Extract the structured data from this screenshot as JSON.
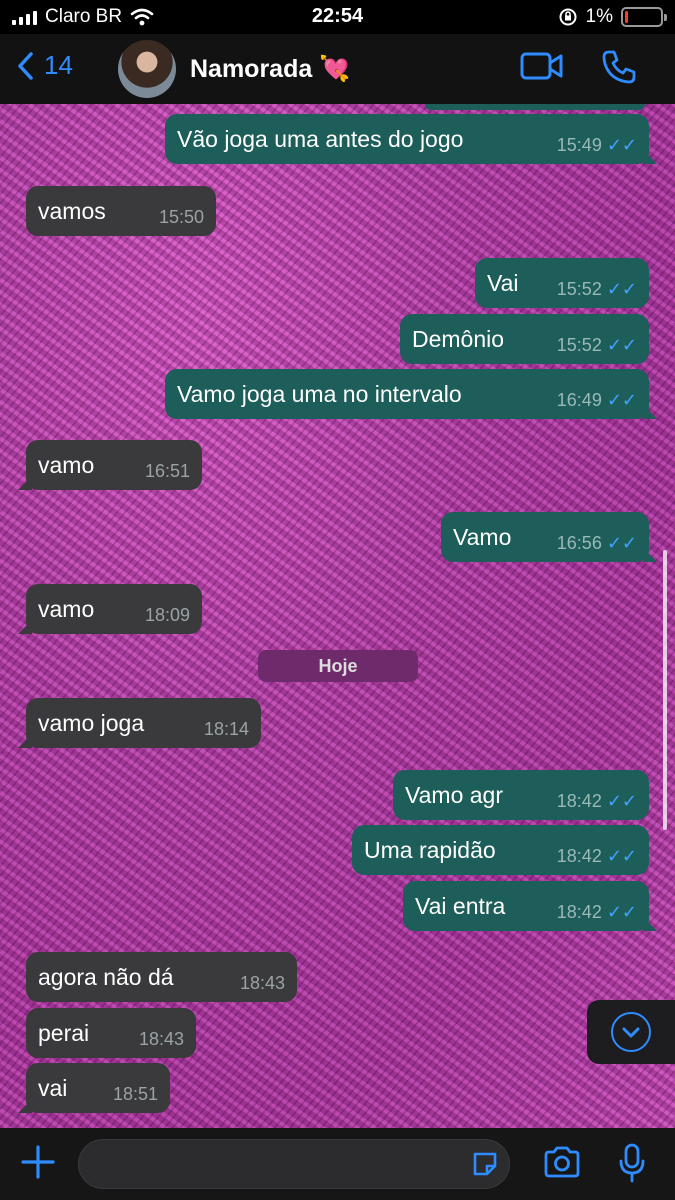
{
  "status_bar": {
    "carrier": "Claro BR",
    "time": "22:54",
    "battery_percent": "1%",
    "battery_level": 0.05,
    "icons": [
      "signal-icon",
      "wifi-icon",
      "rotation-lock-icon",
      "battery-icon"
    ]
  },
  "header": {
    "back_count": "14",
    "contact_name": "Namorada 💘",
    "icons": [
      "chevron-left-icon",
      "video-call-icon",
      "phone-icon"
    ]
  },
  "messages": [
    {
      "dir": "out",
      "text": "Vão joga uma antes do jogo",
      "time": "15:49",
      "read": true
    },
    {
      "dir": "in",
      "text": "vamos",
      "time": "15:50"
    },
    {
      "dir": "out",
      "text": "Vai",
      "time": "15:52",
      "read": true
    },
    {
      "dir": "out",
      "text": "Demônio",
      "time": "15:52",
      "read": true
    },
    {
      "dir": "out",
      "text": "Vamo joga uma no intervalo",
      "time": "16:49",
      "read": true
    },
    {
      "dir": "in",
      "text": "vamo",
      "time": "16:51"
    },
    {
      "dir": "out",
      "text": "Vamo",
      "time": "16:56",
      "read": true
    },
    {
      "dir": "in",
      "text": "vamo",
      "time": "18:09"
    },
    {
      "dir": "in",
      "text": "vamo joga",
      "time": "18:14"
    },
    {
      "dir": "out",
      "text": "Vamo agr",
      "time": "18:42",
      "read": true
    },
    {
      "dir": "out",
      "text": "Uma rapidão",
      "time": "18:42",
      "read": true
    },
    {
      "dir": "out",
      "text": "Vai entra",
      "time": "18:42",
      "read": true
    },
    {
      "dir": "in",
      "text": "agora não dá",
      "time": "18:43"
    },
    {
      "dir": "in",
      "text": "perai",
      "time": "18:43"
    },
    {
      "dir": "in",
      "text": "vai",
      "time": "18:51"
    }
  ],
  "date_divider": "Hoje",
  "read_ticks": "✓✓",
  "colors": {
    "accent": "#2f8cff",
    "incoming_bubble": "#3a3a3c",
    "outgoing_bubble": "#1e5e5a",
    "read_ticks": "#3ea4ff",
    "wallpaper": "#b83eaa"
  },
  "input_bar": {
    "placeholder": "",
    "icons": [
      "plus-icon",
      "sticker-icon",
      "camera-icon",
      "microphone-icon"
    ]
  }
}
